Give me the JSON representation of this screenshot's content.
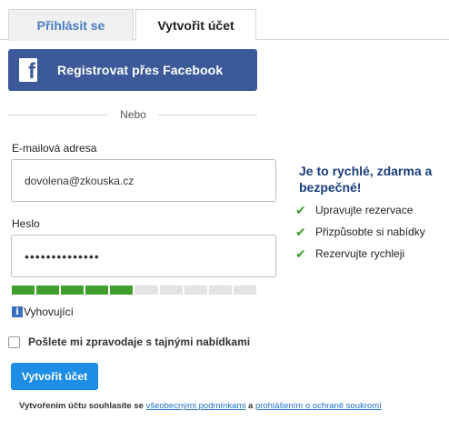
{
  "tabs": {
    "login": "Přihlásit se",
    "create": "Vytvořit účet"
  },
  "facebook": {
    "label": "Registrovat přes Facebook",
    "logo": "f"
  },
  "divider": {
    "text": "Nebo"
  },
  "email": {
    "label": "E-mailová adresa",
    "value": "dovolena@zkouska.cz"
  },
  "password": {
    "label": "Heslo",
    "value": "••••••••••••••",
    "strength_filled": 5,
    "strength_total": 10,
    "strength_label": "Vyhovující"
  },
  "newsletter": {
    "label": "Pošlete mi zpravodaje s tajnými nabídkami",
    "checked": false
  },
  "submit": {
    "label": "Vytvořit účet"
  },
  "terms": {
    "prefix": "Vytvořením účtu souhlasíte se ",
    "link1": "všeobecnými podmínkami",
    "middle": " a ",
    "link2": "prohlášením o ochraně soukromí"
  },
  "promo": {
    "title": "Je to rychlé, zdarma a bezpečné!",
    "benefits": [
      "Upravujte rezervace",
      "Přizpůsobte si nabídky",
      "Rezervujte rychleji"
    ]
  },
  "colors": {
    "facebook": "#3c5a99",
    "primary": "#1d8de5",
    "success": "#3fa02e",
    "promo_title": "#1a3d7c"
  }
}
